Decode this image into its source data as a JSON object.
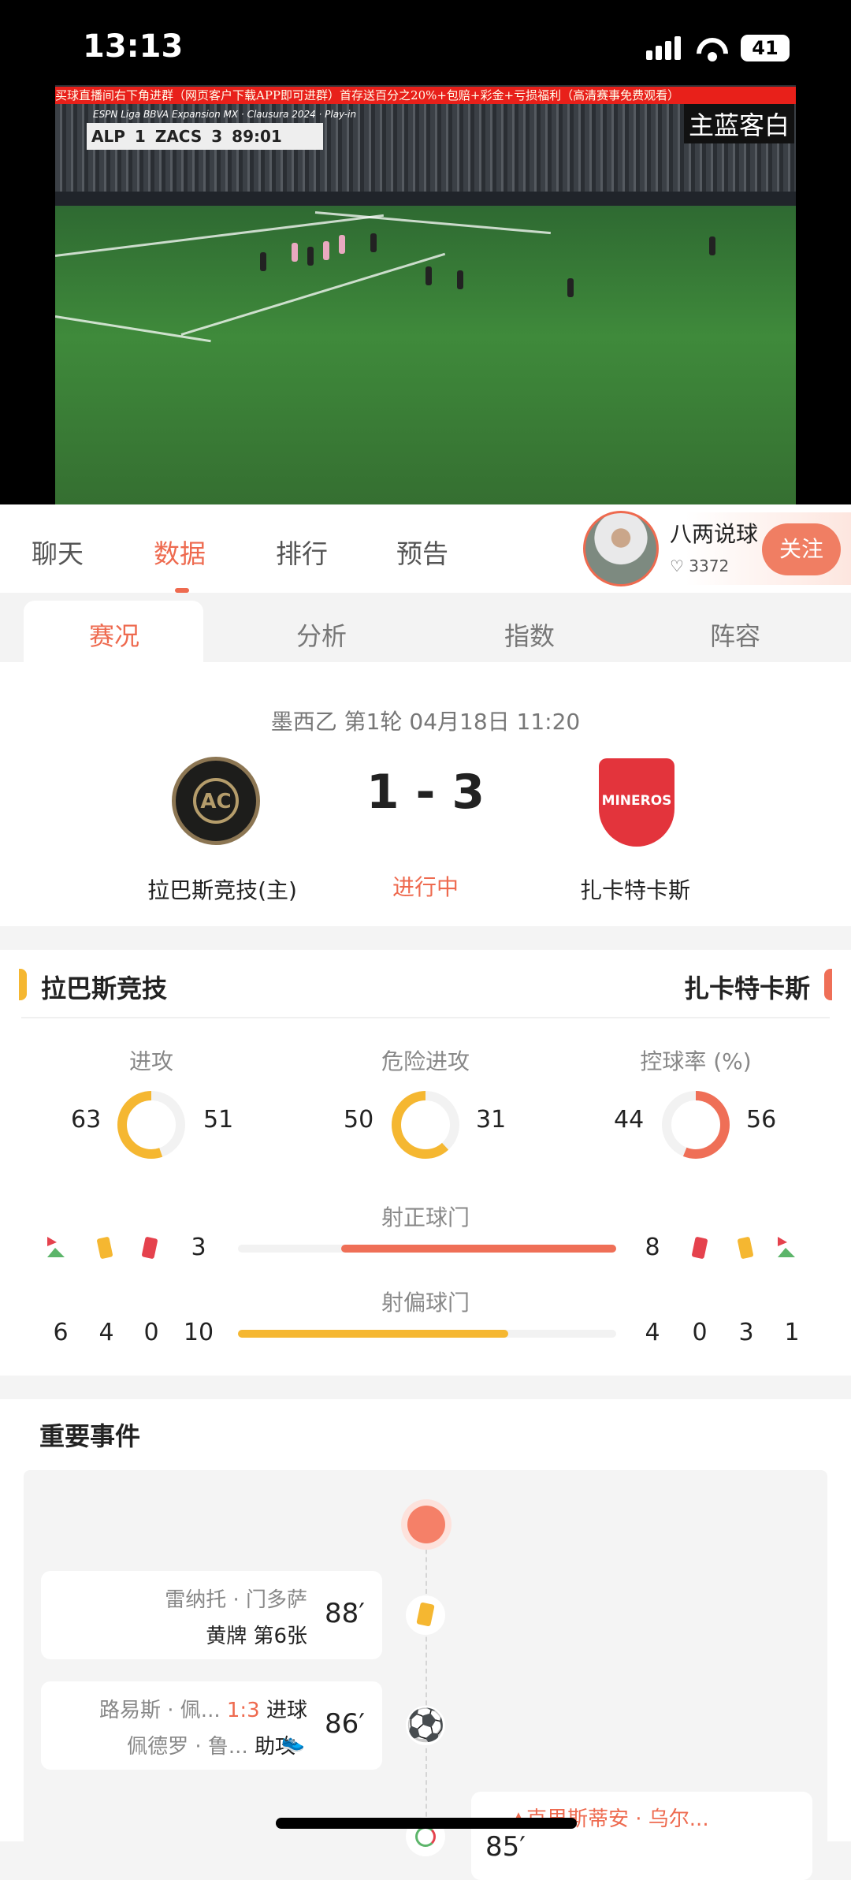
{
  "status_bar": {
    "time": "13:13",
    "battery": "41"
  },
  "video": {
    "banner": "买球直播间右下角进群（网页客户下载APP即可进群）首存送百分之20%+包赔+彩金+亏损福利（高清赛事免费观看）",
    "broadcaster": "ESPN",
    "league_caption": "Liga BBVA Expansion MX · Clausura 2024 · Play-in",
    "home_abbr": "ALP",
    "home_score": "1",
    "away_abbr": "ZACS",
    "away_score": "3",
    "clock": "89:01",
    "kit_note": "主蓝客白"
  },
  "nav": {
    "tabs": [
      {
        "label": "聊天"
      },
      {
        "label": "数据"
      },
      {
        "label": "排行"
      },
      {
        "label": "预告"
      }
    ],
    "active": "数据",
    "streamer": {
      "name": "八两说球",
      "likes": "3372",
      "follow_label": "关注"
    }
  },
  "subtabs": {
    "items": [
      {
        "label": "赛况"
      },
      {
        "label": "分析"
      },
      {
        "label": "指数"
      },
      {
        "label": "阵容"
      }
    ],
    "active": "赛况"
  },
  "match": {
    "meta": "墨西乙  第1轮  04月18日 11:20",
    "home": {
      "name": "拉巴斯竞技(主)",
      "logo_text": "AC",
      "logo_ring": "CLUB ATLETICO · LA PAZ"
    },
    "away": {
      "name": "扎卡特卡斯",
      "logo_text": "MINEROS"
    },
    "score": "1 - 3",
    "status": "进行中"
  },
  "stats": {
    "home_team": "拉巴斯竞技",
    "away_team": "扎卡特卡斯",
    "colors": {
      "home": "#f5b731",
      "away": "#ef6f57",
      "track": "#f2f2f2"
    },
    "donuts": [
      {
        "label": "进攻",
        "home": 63,
        "away": 51
      },
      {
        "label": "危险进攻",
        "home": 50,
        "away": 31
      },
      {
        "label": "控球率 (%)",
        "home": 44,
        "away": 56
      }
    ],
    "shots_on": {
      "label": "射正球门",
      "home": 3,
      "away": 8
    },
    "shots_off": {
      "label": "射偏球门",
      "home": 10,
      "away": 4
    },
    "home_counts": {
      "corners": 6,
      "yellow": 4,
      "red": 0
    },
    "away_counts": {
      "red": 0,
      "yellow": 3,
      "corners": 1
    }
  },
  "events": {
    "title": "重要事件",
    "items": [
      {
        "minute": "88′",
        "player": "雷纳托 · 门多萨",
        "detail": "黄牌 第6张",
        "type": "yellow-card"
      },
      {
        "minute": "86′",
        "player": "路易斯 · 佩...",
        "score": "1:3",
        "detail": "进球",
        "assist": "佩德罗 · 鲁...",
        "assist_label": "助攻",
        "type": "goal"
      },
      {
        "minute": "85′",
        "player": "克里斯蒂安 · 乌尔...",
        "type": "substitution"
      }
    ]
  }
}
